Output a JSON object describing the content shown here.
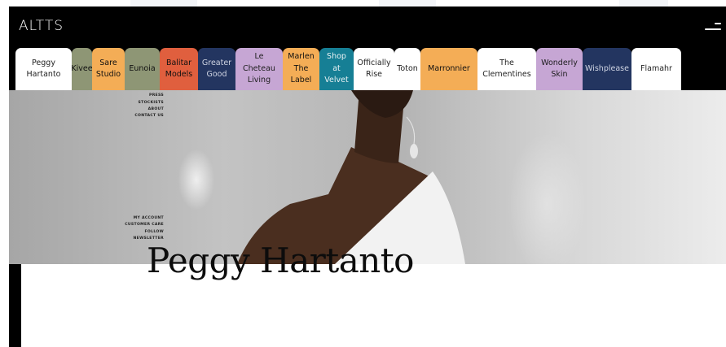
{
  "header": {
    "logo": "ALTTS",
    "menu_icon": "hamburger-menu-icon"
  },
  "tabs": [
    {
      "label": "Peggy\nHartanto",
      "bg": "#ffffff",
      "fg": "#222222"
    },
    {
      "label": "Kivee",
      "bg": "#8e9675",
      "fg": "#111111"
    },
    {
      "label": "Sare\nStudio",
      "bg": "#f4ad56",
      "fg": "#111111"
    },
    {
      "label": "Eunoia",
      "bg": "#8e9675",
      "fg": "#111111"
    },
    {
      "label": "Balitar\nModels",
      "bg": "#e05f3e",
      "fg": "#111111"
    },
    {
      "label": "Greater\nGood",
      "bg": "#233560",
      "fg": "#cfd4e2"
    },
    {
      "label": "Le\nCheteau\nLiving",
      "bg": "#c6a6d4",
      "fg": "#1d1d1d"
    },
    {
      "label": "Marlen\nThe\nLabel",
      "bg": "#f4ad56",
      "fg": "#111111"
    },
    {
      "label": "Shop\nat\nVelvet",
      "bg": "#167f95",
      "fg": "#e8f1f3"
    },
    {
      "label": "Officially\nRise",
      "bg": "#ffffff",
      "fg": "#222222"
    },
    {
      "label": "Toton",
      "bg": "#ffffff",
      "fg": "#222222"
    },
    {
      "label": "Marronnier",
      "bg": "#f4ad56",
      "fg": "#111111"
    },
    {
      "label": "The\nClementines",
      "bg": "#ffffff",
      "fg": "#222222"
    },
    {
      "label": "Wonderly\nSkin",
      "bg": "#c6a6d4",
      "fg": "#1d1d1d"
    },
    {
      "label": "Wishplease",
      "bg": "#233560",
      "fg": "#cfd4e2"
    },
    {
      "label": "Flamahr",
      "bg": "#ffffff",
      "fg": "#222222"
    }
  ],
  "hero": {
    "menu_top": [
      "PROJECT",
      "PRESS",
      "STOCKISTS",
      "ABOUT",
      "CONTACT US"
    ],
    "menu_bottom": [
      "MY ACCOUNT",
      "CUSTOMER CARE",
      "FOLLOW",
      "NEWSLETTER"
    ]
  },
  "title": "Peggy Hartanto",
  "colors": {
    "frame": "#000000",
    "background": "#ffffff",
    "stripe": "#f3f5f8"
  }
}
